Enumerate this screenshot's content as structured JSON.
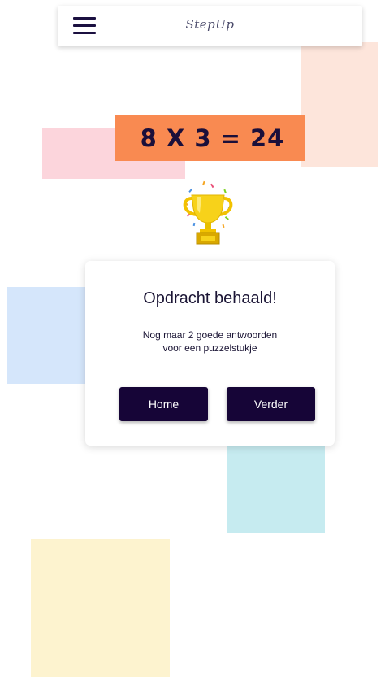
{
  "app": {
    "title": "StepUp"
  },
  "header": {
    "menu_icon": "hamburger-menu-icon"
  },
  "exercise": {
    "equation": "8 X 3 = 24"
  },
  "reward": {
    "icon": "trophy-icon"
  },
  "result_card": {
    "title": "Opdracht behaald!",
    "message_line1": "Nog maar 2 goede antwoorden",
    "message_line2": "voor een puzzelstukje",
    "home_label": "Home",
    "next_label": "Verder"
  },
  "colors": {
    "equation_bg": "#f98a51",
    "button_bg": "#160537",
    "text_dark": "#1b1535"
  }
}
